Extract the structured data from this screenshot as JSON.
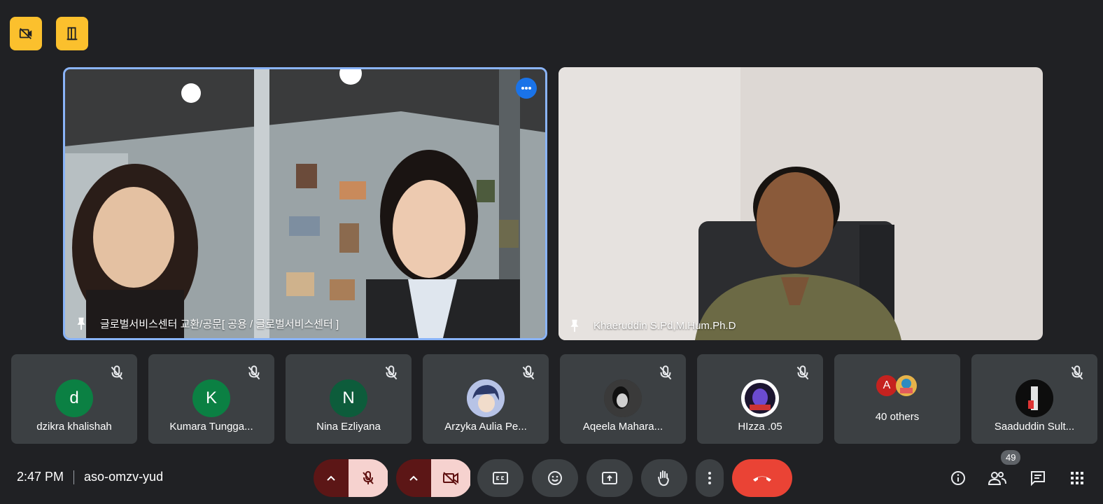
{
  "top_indicators": [
    {
      "icon": "camera-off-icon"
    },
    {
      "icon": "door-exit-icon"
    }
  ],
  "main_tiles": [
    {
      "name": "글로벌서비스센터 교환/공문[ 공용 / 글로벌서비스센터 ]",
      "pinned": true,
      "active_speaker": true
    },
    {
      "name": "Khaeruddin S.Pd,M.Hum.Ph.D",
      "pinned": true
    }
  ],
  "participants": [
    {
      "name": "dzikra khalishah",
      "initial": "d",
      "color": "#0b8043"
    },
    {
      "name": "Kumara Tungga...",
      "initial": "K",
      "color": "#0b8043"
    },
    {
      "name": "Nina Ezliyana",
      "initial": "N",
      "color": "#0d5c3b"
    },
    {
      "name": "Arzyka Aulia Pe...",
      "initial": "",
      "color": "#5b6bb5"
    },
    {
      "name": "Aqeela Mahara...",
      "initial": "",
      "color": "#2b2b2b"
    },
    {
      "name": "HIzza .05",
      "initial": "",
      "color": "#4a3b86"
    },
    {
      "name": "40 others",
      "initial": "A",
      "color": "#c5221f"
    },
    {
      "name": "Saaduddin Sult...",
      "initial": "",
      "color": "#1b1b1b"
    }
  ],
  "meeting": {
    "time": "2:47 PM",
    "code": "aso-omzv-yud"
  },
  "people_count": "49",
  "colors": {
    "background": "#202124",
    "tile": "#3c4043",
    "accent_blue": "#8ab4f8",
    "end_call": "#ea4335",
    "muted_bg": "#f6d2cf"
  }
}
